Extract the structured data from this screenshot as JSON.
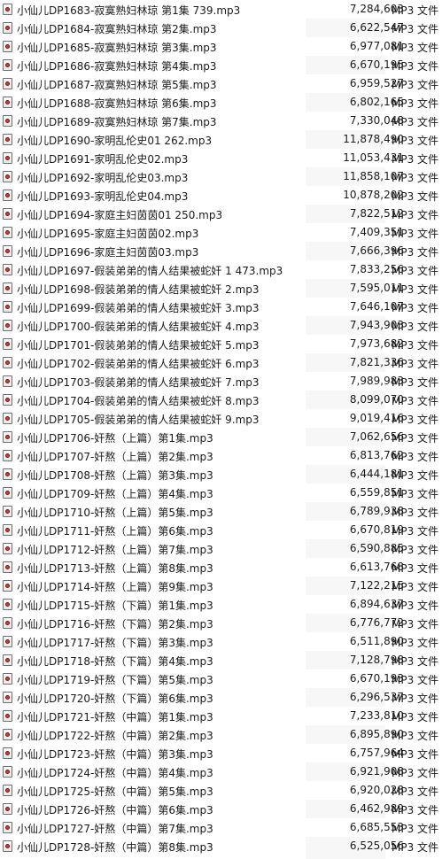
{
  "files": [
    {
      "name": "小仙儿DP1683-寂寞熟妇林琼 第1集 739.mp3",
      "size": "7,284,603",
      "type": "MP3 文件"
    },
    {
      "name": "小仙儿DP1684-寂寞熟妇林琼 第2集.mp3",
      "size": "6,622,547",
      "type": "MP3 文件"
    },
    {
      "name": "小仙儿DP1685-寂寞熟妇林琼 第3集.mp3",
      "size": "6,977,081",
      "type": "MP3 文件"
    },
    {
      "name": "小仙儿DP1686-寂寞熟妇林琼 第4集.mp3",
      "size": "6,670,195",
      "type": "MP3 文件"
    },
    {
      "name": "小仙儿DP1687-寂寞熟妇林琼 第5集.mp3",
      "size": "6,959,527",
      "type": "MP3 文件"
    },
    {
      "name": "小仙儿DP1688-寂寞熟妇林琼 第6集.mp3",
      "size": "6,802,165",
      "type": "MP3 文件"
    },
    {
      "name": "小仙儿DP1689-寂寞熟妇林琼 第7集.mp3",
      "size": "7,330,048",
      "type": "MP3 文件"
    },
    {
      "name": "小仙儿DP1690-家明乱伦史01 262.mp3",
      "size": "11,878,490",
      "type": "MP3 文件"
    },
    {
      "name": "小仙儿DP1691-家明乱伦史02.mp3",
      "size": "11,053,431",
      "type": "MP3 文件"
    },
    {
      "name": "小仙儿DP1692-家明乱伦史03.mp3",
      "size": "11,858,107",
      "type": "MP3 文件"
    },
    {
      "name": "小仙儿DP1693-家明乱伦史04.mp3",
      "size": "10,878,202",
      "type": "MP3 文件"
    },
    {
      "name": "小仙儿DP1694-家庭主妇茵茵01 250.mp3",
      "size": "7,822,512",
      "type": "MP3 文件"
    },
    {
      "name": "小仙儿DP1695-家庭主妇茵茵02.mp3",
      "size": "7,409,351",
      "type": "MP3 文件"
    },
    {
      "name": "小仙儿DP1696-家庭主妇茵茵03.mp3",
      "size": "7,666,396",
      "type": "MP3 文件"
    },
    {
      "name": "小仙儿DP1697-假装弟弟的情人结果被蛇奸 1 473.mp3",
      "size": "7,833,256",
      "type": "MP3 文件"
    },
    {
      "name": "小仙儿DP1698-假装弟弟的情人结果被蛇奸 2.mp3",
      "size": "7,595,011",
      "type": "MP3 文件"
    },
    {
      "name": "小仙儿DP1699-假装弟弟的情人结果被蛇奸 3.mp3",
      "size": "7,646,107",
      "type": "MP3 文件"
    },
    {
      "name": "小仙儿DP1700-假装弟弟的情人结果被蛇奸 4.mp3",
      "size": "7,943,903",
      "type": "MP3 文件"
    },
    {
      "name": "小仙儿DP1701-假装弟弟的情人结果被蛇奸 5.mp3",
      "size": "7,973,682",
      "type": "MP3 文件"
    },
    {
      "name": "小仙儿DP1702-假装弟弟的情人结果被蛇奸 6.mp3",
      "size": "7,821,336",
      "type": "MP3 文件"
    },
    {
      "name": "小仙儿DP1703-假装弟弟的情人结果被蛇奸 7.mp3",
      "size": "7,989,983",
      "type": "MP3 文件"
    },
    {
      "name": "小仙儿DP1704-假装弟弟的情人结果被蛇奸 8.mp3",
      "size": "8,099,070",
      "type": "MP3 文件"
    },
    {
      "name": "小仙儿DP1705-假装弟弟的情人结果被蛇奸 9.mp3",
      "size": "9,019,416",
      "type": "MP3 文件"
    },
    {
      "name": "小仙儿DP1706-奸熬（上篇）第1集.mp3",
      "size": "7,062,656",
      "type": "MP3 文件"
    },
    {
      "name": "小仙儿DP1707-奸熬（上篇）第2集.mp3",
      "size": "6,813,762",
      "type": "MP3 文件"
    },
    {
      "name": "小仙儿DP1708-奸熬（上篇）第3集.mp3",
      "size": "6,444,181",
      "type": "MP3 文件"
    },
    {
      "name": "小仙儿DP1709-奸熬（上篇）第4集.mp3",
      "size": "6,559,851",
      "type": "MP3 文件"
    },
    {
      "name": "小仙儿DP1710-奸熬（上篇）第5集.mp3",
      "size": "6,789,938",
      "type": "MP3 文件"
    },
    {
      "name": "小仙儿DP1711-奸熬（上篇）第6集.mp3",
      "size": "6,670,819",
      "type": "MP3 文件"
    },
    {
      "name": "小仙儿DP1712-奸熬（上篇）第7集.mp3",
      "size": "6,590,885",
      "type": "MP3 文件"
    },
    {
      "name": "小仙儿DP1713-奸熬（上篇）第8集.mp3",
      "size": "6,613,768",
      "type": "MP3 文件"
    },
    {
      "name": "小仙儿DP1714-奸熬（上篇）第9集.mp3",
      "size": "7,122,215",
      "type": "MP3 文件"
    },
    {
      "name": "小仙儿DP1715-奸熬（下篇）第1集.mp3",
      "size": "6,894,637",
      "type": "MP3 文件"
    },
    {
      "name": "小仙儿DP1716-奸熬（下篇）第2集.mp3",
      "size": "6,776,772",
      "type": "MP3 文件"
    },
    {
      "name": "小仙儿DP1717-奸熬（下篇）第3集.mp3",
      "size": "6,511,890",
      "type": "MP3 文件"
    },
    {
      "name": "小仙儿DP1718-奸熬（下篇）第4集.mp3",
      "size": "7,128,798",
      "type": "MP3 文件"
    },
    {
      "name": "小仙儿DP1719-奸熬（下篇）第5集.mp3",
      "size": "6,670,193",
      "type": "MP3 文件"
    },
    {
      "name": "小仙儿DP1720-奸熬（下篇）第6集.mp3",
      "size": "6,296,537",
      "type": "MP3 文件"
    },
    {
      "name": "小仙儿DP1721-奸熬（中篇）第1集.mp3",
      "size": "7,233,810",
      "type": "MP3 文件"
    },
    {
      "name": "小仙儿DP1722-奸熬（中篇）第2集.mp3",
      "size": "6,895,890",
      "type": "MP3 文件"
    },
    {
      "name": "小仙儿DP1723-奸熬（中篇）第3集.mp3",
      "size": "6,757,964",
      "type": "MP3 文件"
    },
    {
      "name": "小仙儿DP1724-奸熬（中篇）第4集.mp3",
      "size": "6,921,908",
      "type": "MP3 文件"
    },
    {
      "name": "小仙儿DP1725-奸熬（中篇）第5集.mp3",
      "size": "6,920,028",
      "type": "MP3 文件"
    },
    {
      "name": "小仙儿DP1726-奸熬（中篇）第6集.mp3",
      "size": "6,462,989",
      "type": "MP3 文件"
    },
    {
      "name": "小仙儿DP1727-奸熬（中篇）第7集.mp3",
      "size": "6,685,553",
      "type": "MP3 文件"
    },
    {
      "name": "小仙儿DP1728-奸熬（中篇）第8集.mp3",
      "size": "6,525,056",
      "type": "MP3 文件"
    }
  ]
}
